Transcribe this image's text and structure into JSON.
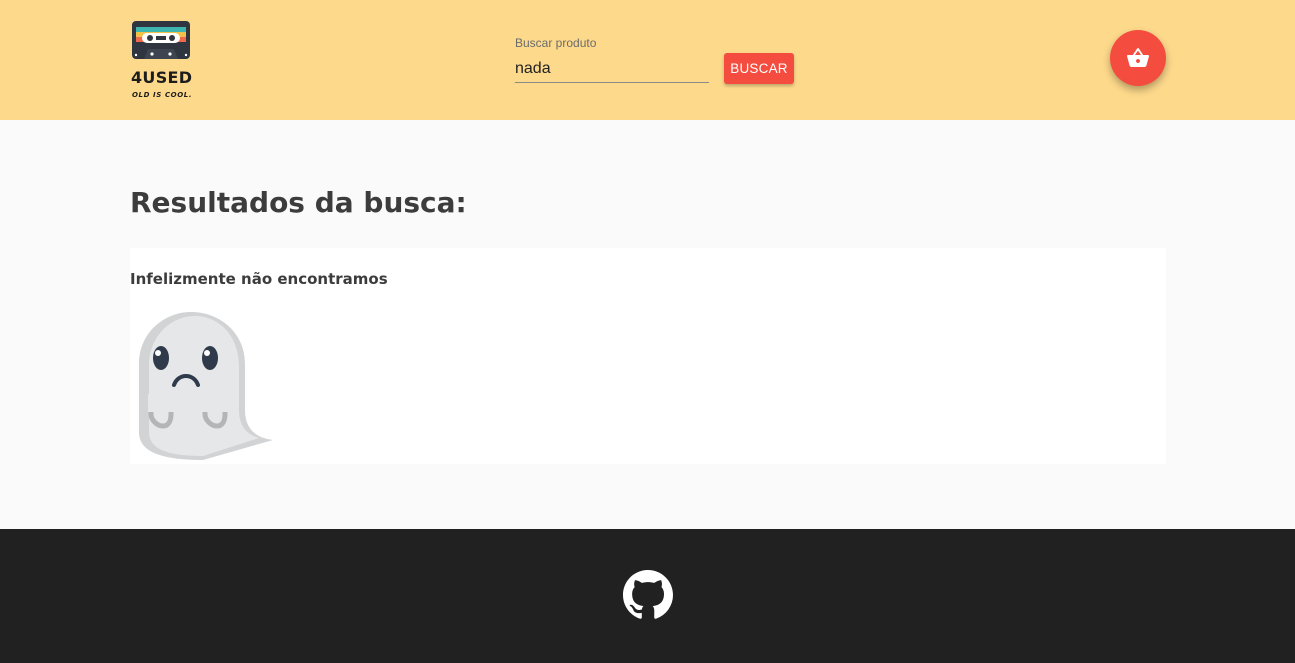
{
  "header": {
    "logo_text": "4USED",
    "logo_tagline": "OLD IS COOL.",
    "search": {
      "label": "Buscar produto",
      "value": "nada"
    },
    "search_button": "BUSCAR",
    "cart_icon": "shopping-basket-icon"
  },
  "main": {
    "title": "Resultados da busca:",
    "empty_message": "Infelizmente não encontramos",
    "empty_illustration": "sad-ghost-illustration"
  },
  "footer": {
    "icon": "github-icon"
  },
  "colors": {
    "header_bg": "#fdd98b",
    "accent": "#f44c3e",
    "footer_bg": "#212121",
    "page_bg": "#fafafa"
  }
}
